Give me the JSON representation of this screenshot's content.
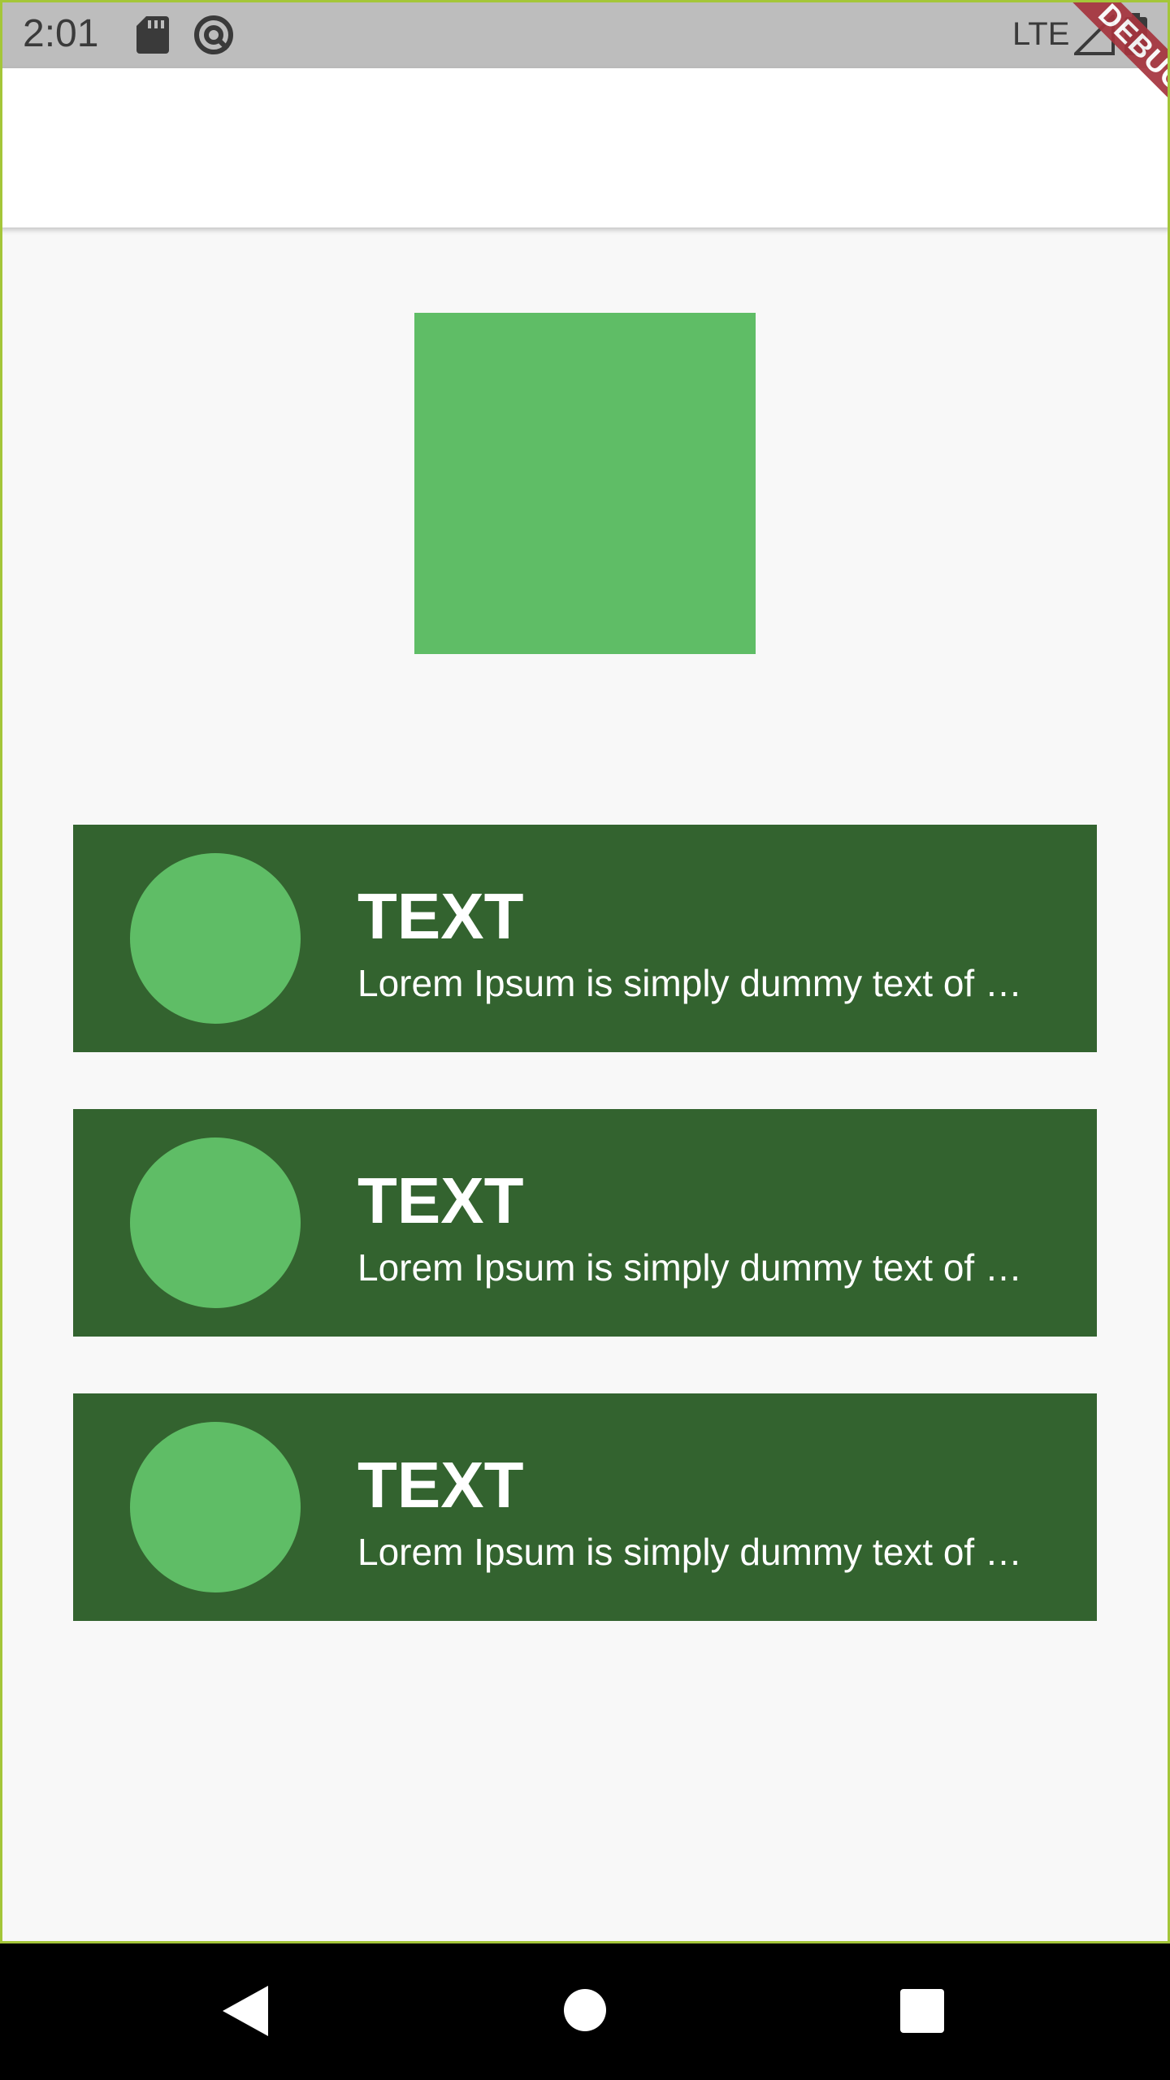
{
  "status_bar": {
    "time": "2:01",
    "network": "LTE",
    "icons": [
      "sd-card-icon",
      "sync-icon",
      "signal-icon",
      "battery-icon"
    ]
  },
  "debug_banner": {
    "label": "DEBUG",
    "color": "#a6343e"
  },
  "hero": {
    "color": "#5fbd66"
  },
  "cards": [
    {
      "title": "TEXT",
      "subtitle": "Lorem Ipsum is simply dummy text of …"
    },
    {
      "title": "TEXT",
      "subtitle": "Lorem Ipsum is simply dummy text of …"
    },
    {
      "title": "TEXT",
      "subtitle": "Lorem Ipsum is simply dummy text of …"
    }
  ],
  "colors": {
    "background": "#f8f8f8",
    "status_bar": "#bdbdbd",
    "card": "#33632f",
    "accent_green": "#5fbd66",
    "nav_bar": "#000000"
  },
  "nav_bar": {
    "icons": [
      "back-icon",
      "home-icon",
      "recents-icon"
    ]
  }
}
